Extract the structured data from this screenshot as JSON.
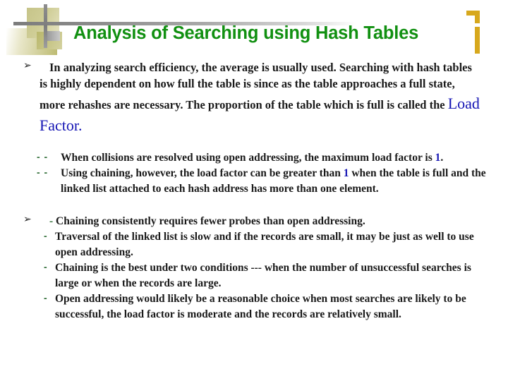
{
  "slide": {
    "title": "Analysis of Searching using Hash Tables",
    "title_color": "#119011",
    "accent_gold": "#d7a81d",
    "accent_khaki": "#c6c489",
    "accent_gray": "#8a8a8a",
    "highlight_blue": "#1414b4",
    "marker_green": "#2d6b34"
  },
  "bullets": {
    "main1": {
      "marker": "➢",
      "text_part1": "In analyzing search efficiency, the average is usually used. Searching with hash tables is highly dependent on how full the table is since as the table approaches a full state, more rehashes are necessary. The proportion of the table which is full is called the ",
      "emphasis": "Load Factor",
      "text_part2": "."
    },
    "sub_items": [
      {
        "marker": "- -",
        "text_before": "When collisions are resolved using open addressing, the maximum load factor is ",
        "highlight": "1",
        "text_after": "."
      },
      {
        "marker": "- -",
        "text_before": "Using chaining, however, the load factor can be greater than ",
        "highlight": "1",
        "text_after": " when the table is full and the linked list attached to each hash address has more than one element."
      }
    ],
    "main2": {
      "marker": "➢",
      "first_line_dash": "-",
      "first_line": "Chaining consistently requires fewer probes than open addressing.",
      "dash_items": [
        {
          "marker": "-",
          "text": "Traversal of the linked list is slow and if the records are small, it may be just as well to use open addressing."
        },
        {
          "marker": "-",
          "text": "Chaining is the best under two conditions --- when the number of unsuccessful searches is large or when the records are large."
        },
        {
          "marker": "-",
          "text": "Open addressing would likely be a reasonable choice when most searches are likely to be successful, the load factor is moderate and the records are relatively small."
        }
      ]
    }
  }
}
